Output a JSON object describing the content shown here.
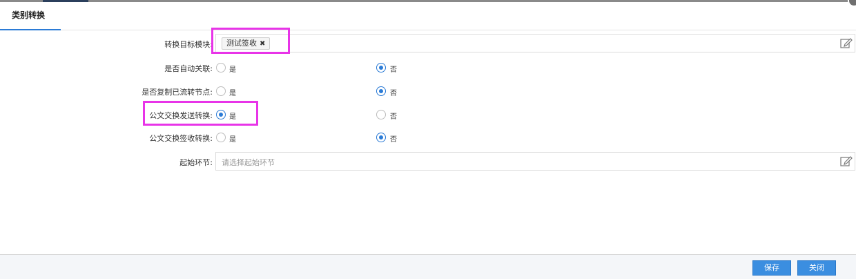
{
  "tab": {
    "title": "类别转换"
  },
  "form": {
    "target_module_label": "转换目标模块:",
    "target_module_tag": "测试签收",
    "target_module_tag_remove": "✖",
    "auto_link_label": "是否自动关联:",
    "copy_nodes_label": "是否复制已流转节点:",
    "doc_send_label": "公文交换发送转换:",
    "doc_receive_label": "公文交换签收转换:",
    "start_node_label": "起始环节:",
    "start_node_placeholder": "请选择起始环节",
    "yes_label": "是",
    "no_label": "否"
  },
  "values": {
    "auto_link": "否",
    "copy_nodes": "否",
    "doc_send": "是",
    "doc_receive": "否"
  },
  "footer": {
    "save_label": "保存",
    "close_label": "关闭"
  },
  "colors": {
    "accent": "#2b7bd6",
    "highlight": "#e834e8",
    "button": "#3b8ee0"
  }
}
